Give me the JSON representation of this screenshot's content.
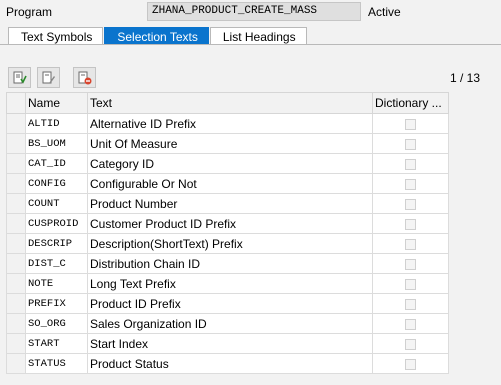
{
  "header": {
    "program_label": "Program",
    "program_name": "ZHANA_PRODUCT_CREATE_MASS",
    "status": "Active"
  },
  "tabs": [
    {
      "label": "Text Symbols",
      "active": false
    },
    {
      "label": "Selection Texts",
      "active": true
    },
    {
      "label": "List Headings",
      "active": false
    }
  ],
  "toolbar": {
    "page_counter": "1 / 13",
    "buttons": [
      "check-icon",
      "edit-icon",
      "delete-icon"
    ]
  },
  "table": {
    "headers": {
      "name": "Name",
      "text": "Text",
      "dictionary": "Dictionary ..."
    },
    "rows": [
      {
        "name": "ALTID",
        "text": "Alternative ID Prefix",
        "dictionary": false
      },
      {
        "name": "BS_UOM",
        "text": "Unit Of Measure",
        "dictionary": false
      },
      {
        "name": "CAT_ID",
        "text": "Category ID",
        "dictionary": false
      },
      {
        "name": "CONFIG",
        "text": "Configurable Or Not",
        "dictionary": false
      },
      {
        "name": "COUNT",
        "text": "Product Number",
        "dictionary": false
      },
      {
        "name": "CUSPROID",
        "text": "Customer Product ID Prefix",
        "dictionary": false
      },
      {
        "name": "DESCRIP",
        "text": "Description(ShortText) Prefix",
        "dictionary": false
      },
      {
        "name": "DIST_C",
        "text": "Distribution Chain ID",
        "dictionary": false
      },
      {
        "name": "NOTE",
        "text": "Long Text Prefix",
        "dictionary": false
      },
      {
        "name": "PREFIX",
        "text": "Product ID Prefix",
        "dictionary": false
      },
      {
        "name": "SO_ORG",
        "text": "Sales Organization ID",
        "dictionary": false
      },
      {
        "name": "START",
        "text": "Start Index",
        "dictionary": false
      },
      {
        "name": "STATUS",
        "text": "Product Status",
        "dictionary": false
      }
    ]
  },
  "colors": {
    "active_tab": "#0a74cd",
    "focus_corner": "#d04040",
    "background": "#f2f2f2"
  }
}
